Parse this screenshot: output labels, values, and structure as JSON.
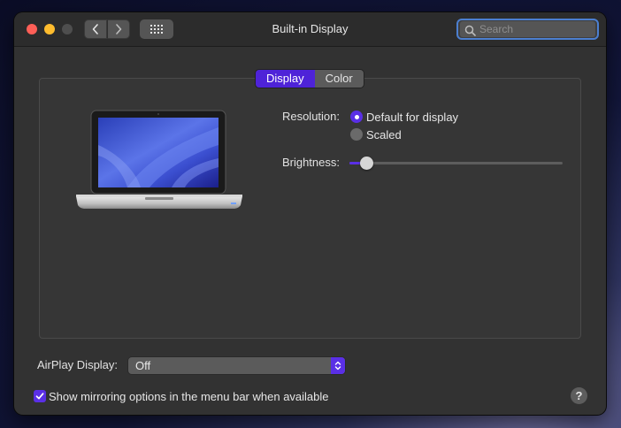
{
  "window": {
    "title": "Built-in Display"
  },
  "search": {
    "placeholder": "Search",
    "value": ""
  },
  "tabs": [
    {
      "label": "Display",
      "active": true
    },
    {
      "label": "Color",
      "active": false
    }
  ],
  "resolution": {
    "label": "Resolution:",
    "options": [
      {
        "label": "Default for display",
        "selected": true
      },
      {
        "label": "Scaled",
        "selected": false
      }
    ]
  },
  "brightness": {
    "label": "Brightness:",
    "level_percent": 8
  },
  "airplay": {
    "label": "AirPlay Display:",
    "value": "Off"
  },
  "mirroring": {
    "label": "Show mirroring options in the menu bar when available",
    "checked": true
  },
  "help": {
    "label": "?"
  },
  "colors": {
    "accent": "#5a2fe6",
    "close": "#fe5f57",
    "minimize": "#febc2e",
    "zoom_disabled": "#4e4e4e"
  },
  "icons": [
    "chevron-left-icon",
    "chevron-right-icon",
    "grid-icon",
    "search-icon",
    "laptop-icon",
    "updown-arrows-icon",
    "checkmark-icon"
  ]
}
